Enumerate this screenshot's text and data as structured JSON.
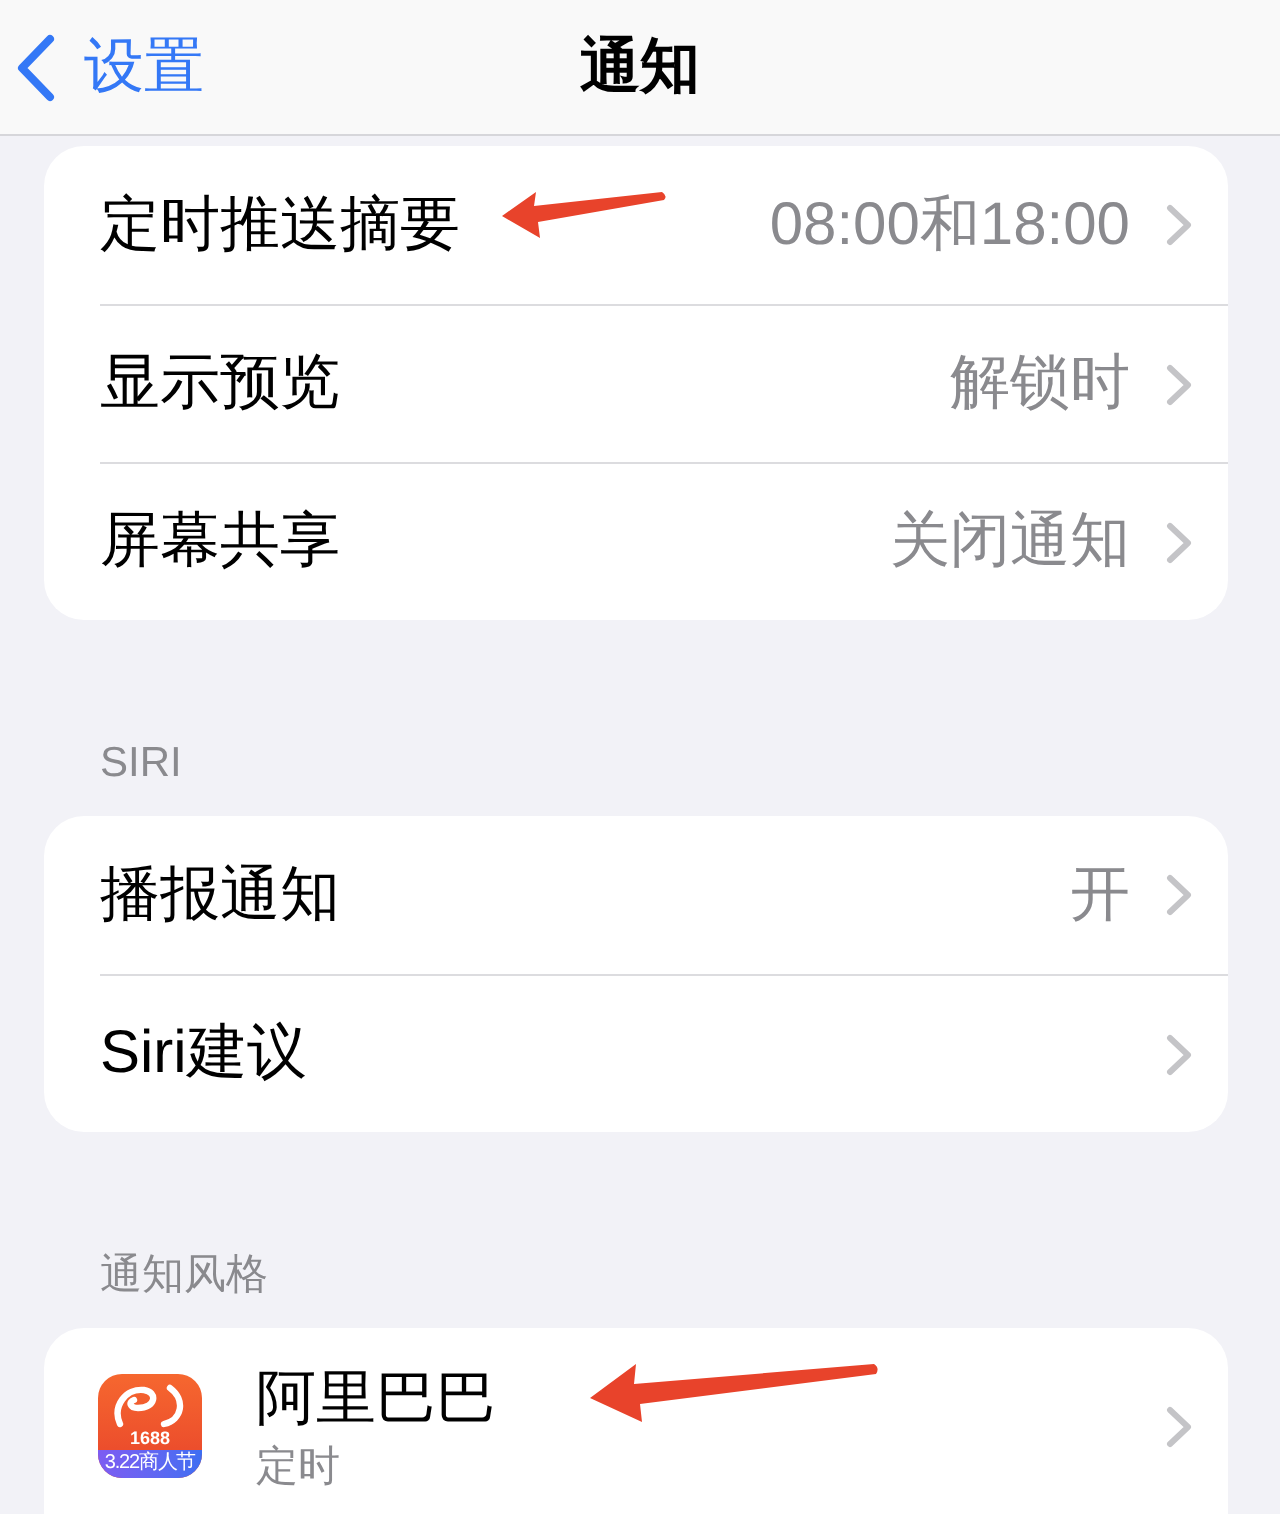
{
  "nav_bar": {
    "back_label": "设置",
    "title": "通知"
  },
  "sections": [
    {
      "rows": [
        {
          "kind": "value",
          "label": "定时推送摘要",
          "value": "08:00和18:00",
          "annotated": true
        },
        {
          "kind": "value",
          "label": "显示预览",
          "value": "解锁时",
          "annotated": false
        },
        {
          "kind": "value",
          "label": "屏幕共享",
          "value": "关闭通知",
          "annotated": false
        }
      ]
    },
    {
      "header": "SIRI",
      "rows": [
        {
          "kind": "value",
          "label": "播报通知",
          "value": "开",
          "annotated": false
        },
        {
          "kind": "value",
          "label": "Siri建议",
          "annotated": false
        }
      ]
    },
    {
      "header": "通知风格",
      "rows": [
        {
          "kind": "app",
          "label": "阿里巴巴",
          "subtitle": "定时",
          "icon_badge": "1688",
          "icon_banner": "3.22商人节",
          "annotated": true
        }
      ]
    }
  ]
}
